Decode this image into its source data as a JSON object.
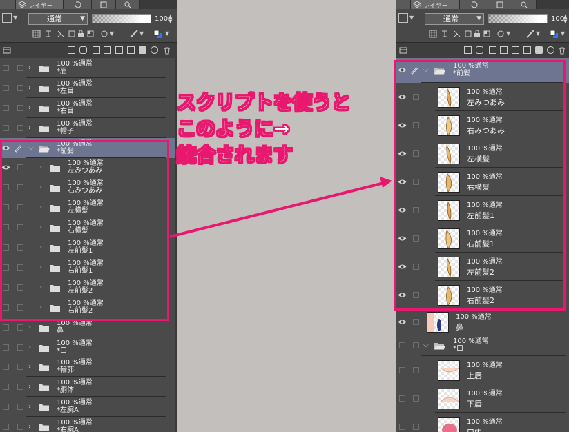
{
  "left_panel": {
    "tab_label": "レイヤー",
    "blend_mode": "通常",
    "opacity": "100",
    "layers": [
      {
        "l1": "100 %通常",
        "l2": "*眉"
      },
      {
        "l1": "100 %通常",
        "l2": "*左目"
      },
      {
        "l1": "100 %通常",
        "l2": "*右目"
      },
      {
        "l1": "100 %通常",
        "l2": "*帽子"
      },
      {
        "l1": "100 %通常",
        "l2": "*前髪"
      },
      {
        "l1": "100 %通常",
        "l2": "左みつあみ"
      },
      {
        "l1": "100 %通常",
        "l2": "右みつあみ"
      },
      {
        "l1": "100 %通常",
        "l2": "左横髪"
      },
      {
        "l1": "100 %通常",
        "l2": "右横髪"
      },
      {
        "l1": "100 %通常",
        "l2": "左前髪1"
      },
      {
        "l1": "100 %通常",
        "l2": "右前髪1"
      },
      {
        "l1": "100 %通常",
        "l2": "左前髪2"
      },
      {
        "l1": "100 %通常",
        "l2": "右前髪2"
      },
      {
        "l1": "100 %通常",
        "l2": "鼻"
      },
      {
        "l1": "100 %通常",
        "l2": "*口"
      },
      {
        "l1": "100 %通常",
        "l2": "*輪郭"
      },
      {
        "l1": "100 %通常",
        "l2": "*胴体"
      },
      {
        "l1": "100 %通常",
        "l2": "*左腕A"
      },
      {
        "l1": "100 %通常",
        "l2": "*右腕A"
      }
    ]
  },
  "right_panel": {
    "tab_label": "レイヤー",
    "blend_mode": "通常",
    "opacity": "100",
    "layers": [
      {
        "l1": "100 %通常",
        "l2": "*前髪"
      },
      {
        "l1": "100 %通常",
        "l2": "左みつあみ"
      },
      {
        "l1": "100 %通常",
        "l2": "右みつあみ"
      },
      {
        "l1": "100 %通常",
        "l2": "左横髪"
      },
      {
        "l1": "100 %通常",
        "l2": "右横髪"
      },
      {
        "l1": "100 %通常",
        "l2": "左前髪1"
      },
      {
        "l1": "100 %通常",
        "l2": "右前髪1"
      },
      {
        "l1": "100 %通常",
        "l2": "左前髪2"
      },
      {
        "l1": "100 %通常",
        "l2": "右前髪2"
      },
      {
        "l1": "100 %通常",
        "l2": "鼻"
      },
      {
        "l1": "100 %通常",
        "l2": "*口"
      },
      {
        "l1": "100 %通常",
        "l2": "上唇"
      },
      {
        "l1": "100 %通常",
        "l2": "下唇"
      },
      {
        "l1": "100 %通常",
        "l2": "口内"
      }
    ]
  },
  "annotation": {
    "line1": "スクリプトを使うと",
    "line2": "このように→",
    "line3": "統合されます"
  },
  "colors": {
    "highlight": "#e8186e",
    "selected_row": "#6e7590",
    "panel_bg": "#484848",
    "canvas_bg": "#c3bfbd"
  }
}
